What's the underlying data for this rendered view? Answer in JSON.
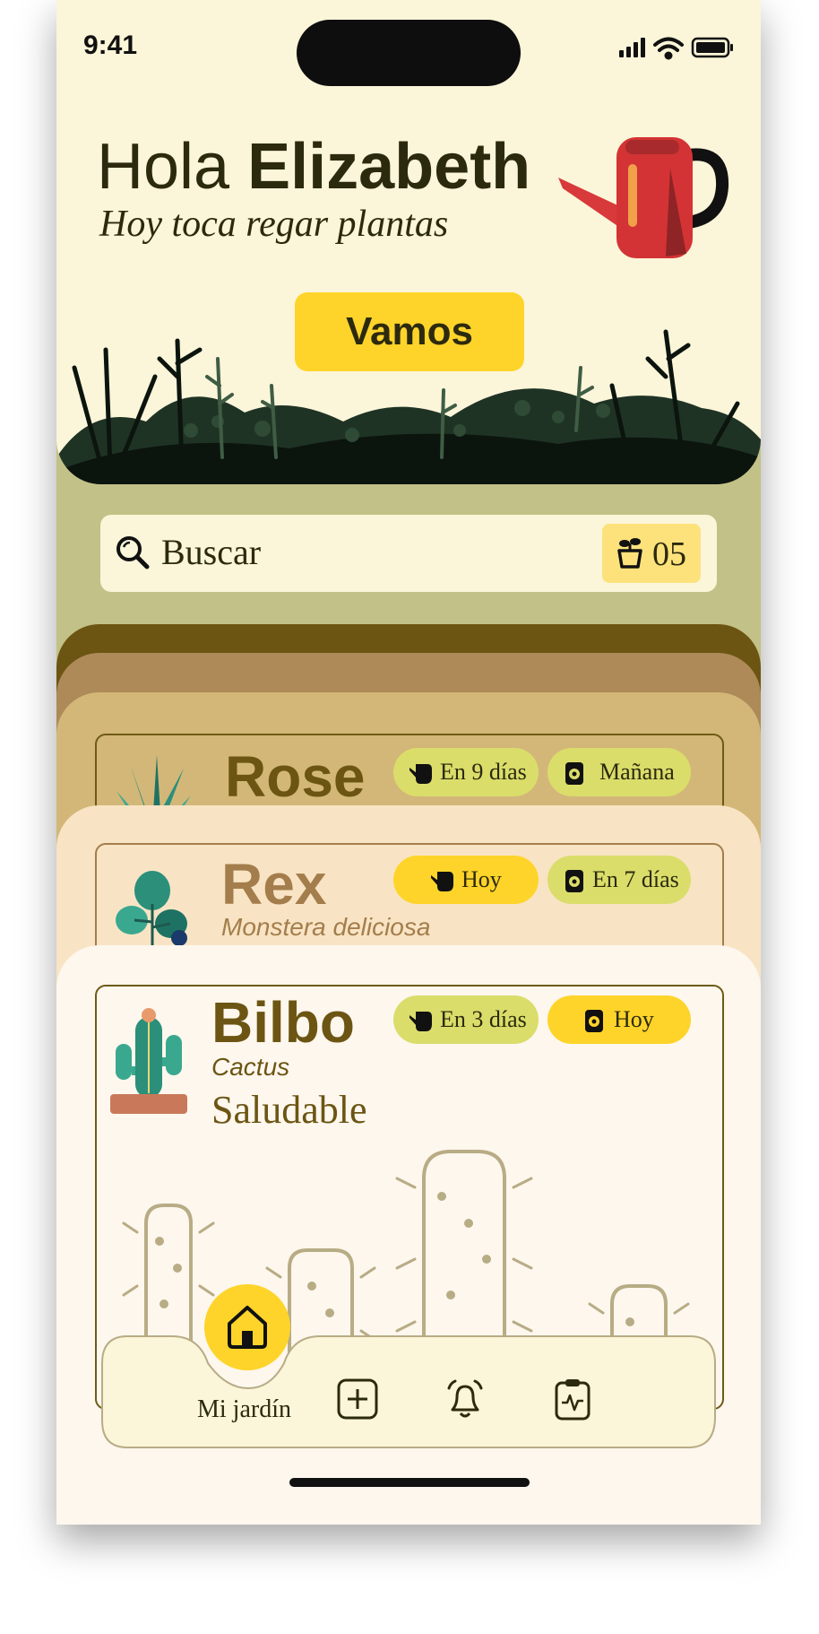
{
  "status_bar": {
    "time": "9:41"
  },
  "header": {
    "greeting_prefix": "Hola",
    "user_name": "Elizabeth",
    "subtitle": "Hoy toca regar  plantas",
    "cta_label": "Vamos"
  },
  "search": {
    "placeholder": "Buscar",
    "plant_count": "05"
  },
  "plants": [
    {
      "name": "Rose",
      "watering": "En 9 días",
      "fertilizer": "Mañana"
    },
    {
      "name": "Rex",
      "species": "Monstera deliciosa",
      "watering": "Hoy",
      "fertilizer": "En 7 días"
    },
    {
      "name": "Bilbo",
      "species": "Cactus",
      "status": "Saludable",
      "watering": "En 3 días",
      "fertilizer": "Hoy"
    }
  ],
  "nav": {
    "home_label": "Mi jardín"
  },
  "colors": {
    "accent_yellow": "#fed42a",
    "chip_green": "#dadd6a",
    "hero_bg": "#fbf5d9",
    "olive_bg": "#c2c187",
    "dark_text": "#2c2a0e"
  },
  "icons": [
    "watering-can-icon",
    "search-icon",
    "plant-pot-icon",
    "fertilizer-bag-icon",
    "home-icon",
    "add-icon",
    "bell-icon",
    "clipboard-icon"
  ]
}
